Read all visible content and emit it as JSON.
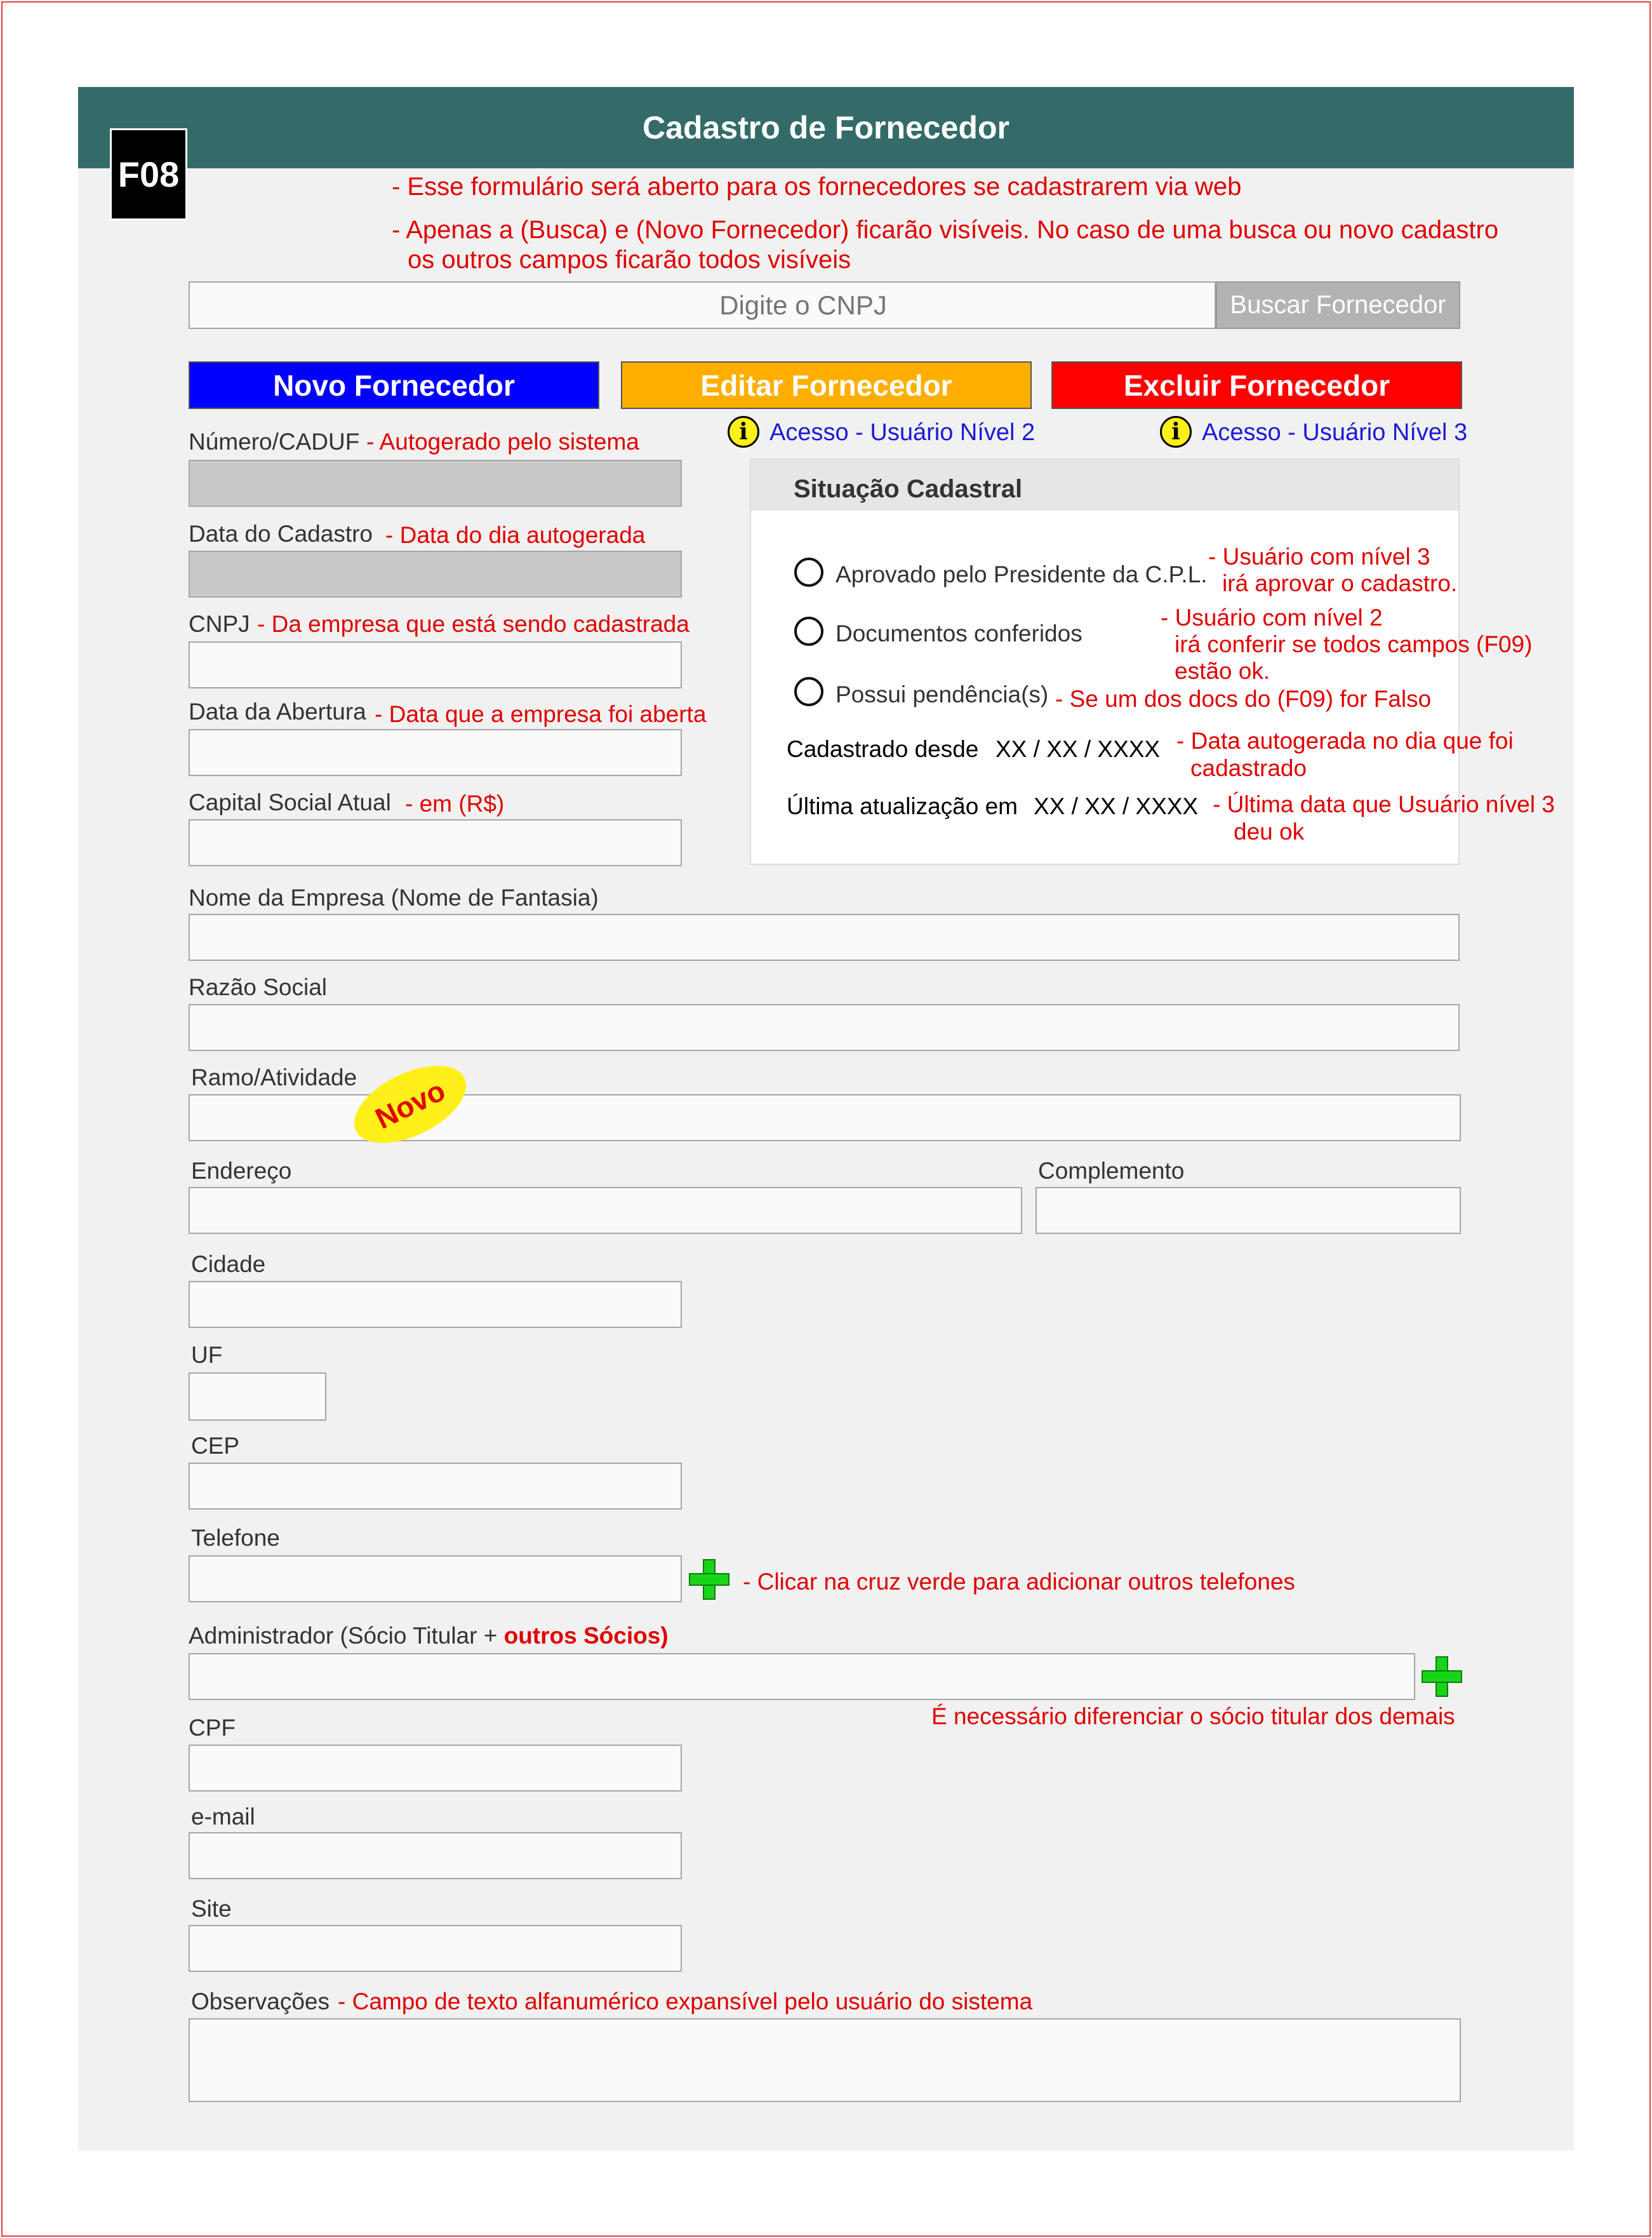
{
  "form_code": "F08",
  "title": "Cadastro de Fornecedor",
  "intro_notes": [
    "- Esse formulário será aberto para os fornecedores se cadastrarem via web",
    "- Apenas a (Busca) e (Novo Fornecedor) ficarão visíveis. No caso de uma busca ou novo cadastro",
    "os outros campos ficarão todos visíveis"
  ],
  "search": {
    "placeholder": "Digite o CNPJ",
    "button_label": "Buscar Fornecedor"
  },
  "actions": {
    "new_label": "Novo Fornecedor",
    "edit_label": "Editar Fornecedor",
    "delete_label": "Excluir Fornecedor",
    "edit_access": "Acesso - Usuário Nível 2",
    "delete_access": "Acesso - Usuário Nível 3",
    "info_icon_glyph": "i",
    "colors": {
      "new": "#0000ff",
      "edit": "#ffae00",
      "delete": "#ff0000"
    }
  },
  "fields": {
    "numero": {
      "label": "Número/CADUF",
      "note": "- Autogerado pelo sistema"
    },
    "data_cadastro": {
      "label": "Data do Cadastro",
      "note": "- Data do dia autogerada"
    },
    "cnpj": {
      "label": "CNPJ",
      "note": "- Da empresa que está sendo cadastrada"
    },
    "data_abertura": {
      "label": "Data da Abertura",
      "note": "- Data que a empresa foi aberta"
    },
    "capital": {
      "label": "Capital Social Atual",
      "note": "- em (R$)"
    },
    "nome_empresa": {
      "label": "Nome da Empresa (Nome de Fantasia)"
    },
    "razao_social": {
      "label": "Razão Social"
    },
    "ramo": {
      "label": "Ramo/Atividade",
      "badge": "Novo"
    },
    "endereco": {
      "label": "Endereço"
    },
    "complemento": {
      "label": "Complemento"
    },
    "cidade": {
      "label": "Cidade"
    },
    "uf": {
      "label": "UF"
    },
    "cep": {
      "label": "CEP"
    },
    "telefone": {
      "label": "Telefone",
      "note": "- Clicar na cruz verde para adicionar outros telefones"
    },
    "administrador": {
      "label": "Administrador (Sócio Titular + ",
      "label_bold": "outros Sócios)",
      "note": "É necessário diferenciar o sócio titular dos demais"
    },
    "cpf": {
      "label": "CPF"
    },
    "email": {
      "label": "e-mail"
    },
    "site": {
      "label": "Site"
    },
    "observacoes": {
      "label": "Observações",
      "note": "- Campo de texto alfanumérico expansível pelo usuário do sistema"
    }
  },
  "situacao": {
    "title": "Situação Cadastral",
    "options": [
      {
        "label": "Aprovado pelo Presidente da C.P.L.",
        "note": [
          "- Usuário com nível 3",
          "irá aprovar o cadastro."
        ]
      },
      {
        "label": "Documentos conferidos",
        "note": [
          "- Usuário com nível 2",
          "irá conferir se todos campos (F09)",
          "estão ok."
        ]
      },
      {
        "label": "Possui pendência(s)",
        "note": [
          "- Se um dos docs do (F09) for Falso"
        ]
      }
    ],
    "cadastrado_label": "Cadastrado desde",
    "cadastrado_value": "XX / XX / XXXX",
    "cadastrado_note": [
      "- Data autogerada no dia que foi",
      "cadastrado"
    ],
    "atualizacao_label": "Última atualização em",
    "atualizacao_value": "XX / XX / XXXX",
    "atualizacao_note": [
      "- Última data que Usuário nível 3",
      "deu ok"
    ]
  }
}
